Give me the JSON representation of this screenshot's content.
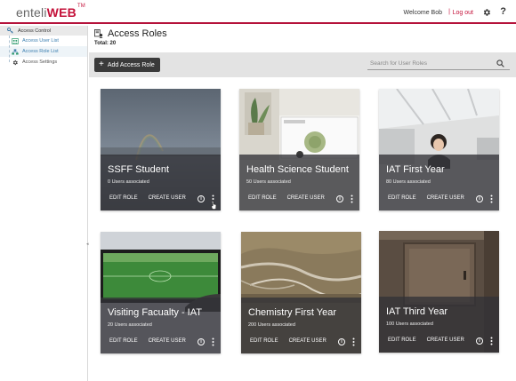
{
  "header": {
    "logo_light": "enteli",
    "logo_bold": "WEB",
    "logo_tm": "TM",
    "welcome": "Welcome Bob",
    "separator": "|",
    "logout": "Log out",
    "help": "?",
    "brand_color": "#c4123a"
  },
  "sidebar": {
    "section": "Access Control",
    "items": [
      {
        "label": "Access User List",
        "icon": "users-icon"
      },
      {
        "label": "Access Role List",
        "icon": "role-tree-icon"
      },
      {
        "label": "Access Settings",
        "icon": "gear-icon"
      }
    ],
    "collapse": "◂"
  },
  "main": {
    "title": "Access Roles",
    "total": "Total: 20",
    "add_button": "Add Access Role",
    "search_placeholder": "Search for User Roles"
  },
  "cards": [
    {
      "name": "SSFF Student",
      "count": "0 Users associated",
      "edit": "EDIT ROLE",
      "create": "CREATE USER",
      "info": "i"
    },
    {
      "name": "Health Science Student",
      "count": "50 Users associated",
      "edit": "EDIT ROLE",
      "create": "CREATE USER",
      "info": "i"
    },
    {
      "name": "IAT First Year",
      "count": "80 Users associated",
      "edit": "EDIT ROLE",
      "create": "CREATE USER",
      "info": "i"
    },
    {
      "name": "Visiting Facualty - IAT",
      "count": "20 Users associated",
      "edit": "EDIT ROLE",
      "create": "CREATE USER",
      "info": "i"
    },
    {
      "name": "Chemistry First Year",
      "count": "200 Users associated",
      "edit": "EDIT ROLE",
      "create": "CREATE USER",
      "info": "i"
    },
    {
      "name": "IAT Third Year",
      "count": "100 Users associated",
      "edit": "EDIT ROLE",
      "create": "CREATE USER",
      "info": "i"
    }
  ]
}
